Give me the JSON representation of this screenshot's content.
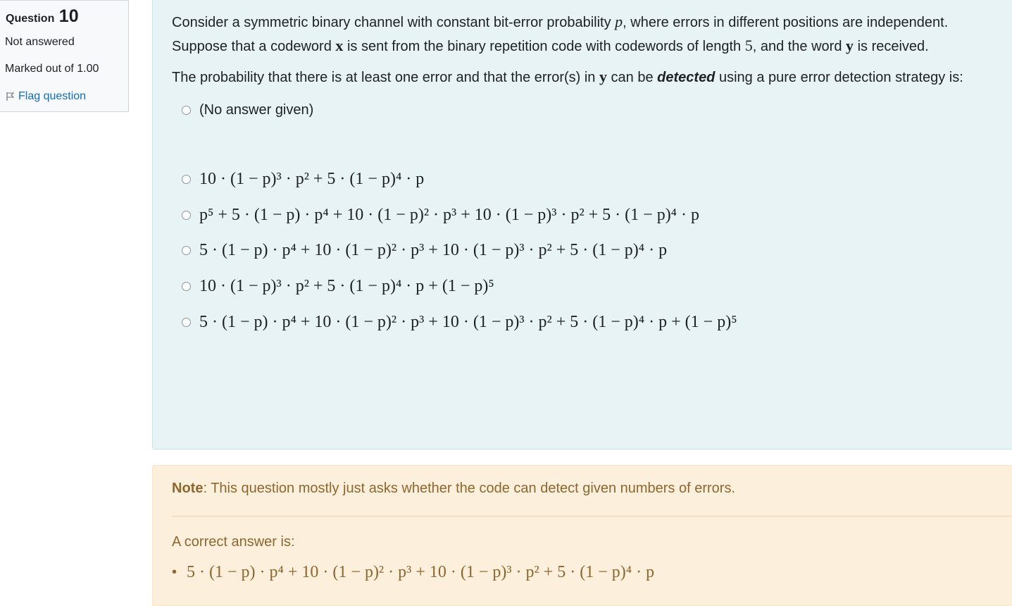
{
  "info": {
    "question_word": "Question",
    "question_number": "10",
    "state": "Not answered",
    "grade": "Marked out of 1.00",
    "flag_label": "Flag question"
  },
  "question": {
    "line1_a": "Consider a symmetric binary channel with constant bit-error probability ",
    "var_p": "p",
    "line1_b": ", where errors in different positions are independent.",
    "line2_a": "Suppose that a codeword ",
    "var_x": "x",
    "line2_b": " is sent from the binary repetition code with codewords of length ",
    "length": "5",
    "line2_c": ", and the word ",
    "var_y": "y",
    "line2_d": " is received.",
    "line3_a": "The probability that there is at least one error and that the error(s) in ",
    "line3_b": " can be ",
    "emph": "detected",
    "line3_c": " using a pure error detection strategy is:"
  },
  "options": {
    "no_answer": "(No answer given)",
    "formulas": [
      "10 · (1 − p)³ · p² + 5 · (1 − p)⁴ · p",
      "p⁵ + 5 · (1 − p) · p⁴ + 10 · (1 − p)² · p³ + 10 · (1 − p)³ · p² + 5 · (1 − p)⁴ · p",
      "5 · (1 − p) · p⁴ + 10 · (1 − p)² · p³ + 10 · (1 − p)³ · p² + 5 · (1 − p)⁴ · p",
      "10 · (1 − p)³ · p² + 5 · (1 − p)⁴ · p + (1 − p)⁵",
      "5 · (1 − p) · p⁴ + 10 · (1 − p)² · p³ + 10 · (1 − p)³ · p² + 5 · (1 − p)⁴ · p + (1 − p)⁵"
    ]
  },
  "feedback": {
    "note_label": "Note",
    "note_text": ": This question mostly just asks whether the code can detect given numbers of errors.",
    "right_label": "A correct answer is:",
    "bullet": "•",
    "right_answer": "5 · (1 − p) · p⁴ + 10 · (1 − p)² · p³ + 10 · (1 − p)³ · p² + 5 · (1 − p)⁴ · p"
  },
  "icons": {
    "flag": "flag-icon",
    "radio": "radio-icon"
  },
  "colors": {
    "link": "#0f6cbf",
    "question_bg": "#e7f3f5",
    "feedback_bg": "#fcefdc",
    "feedback_text": "#8e662e"
  }
}
